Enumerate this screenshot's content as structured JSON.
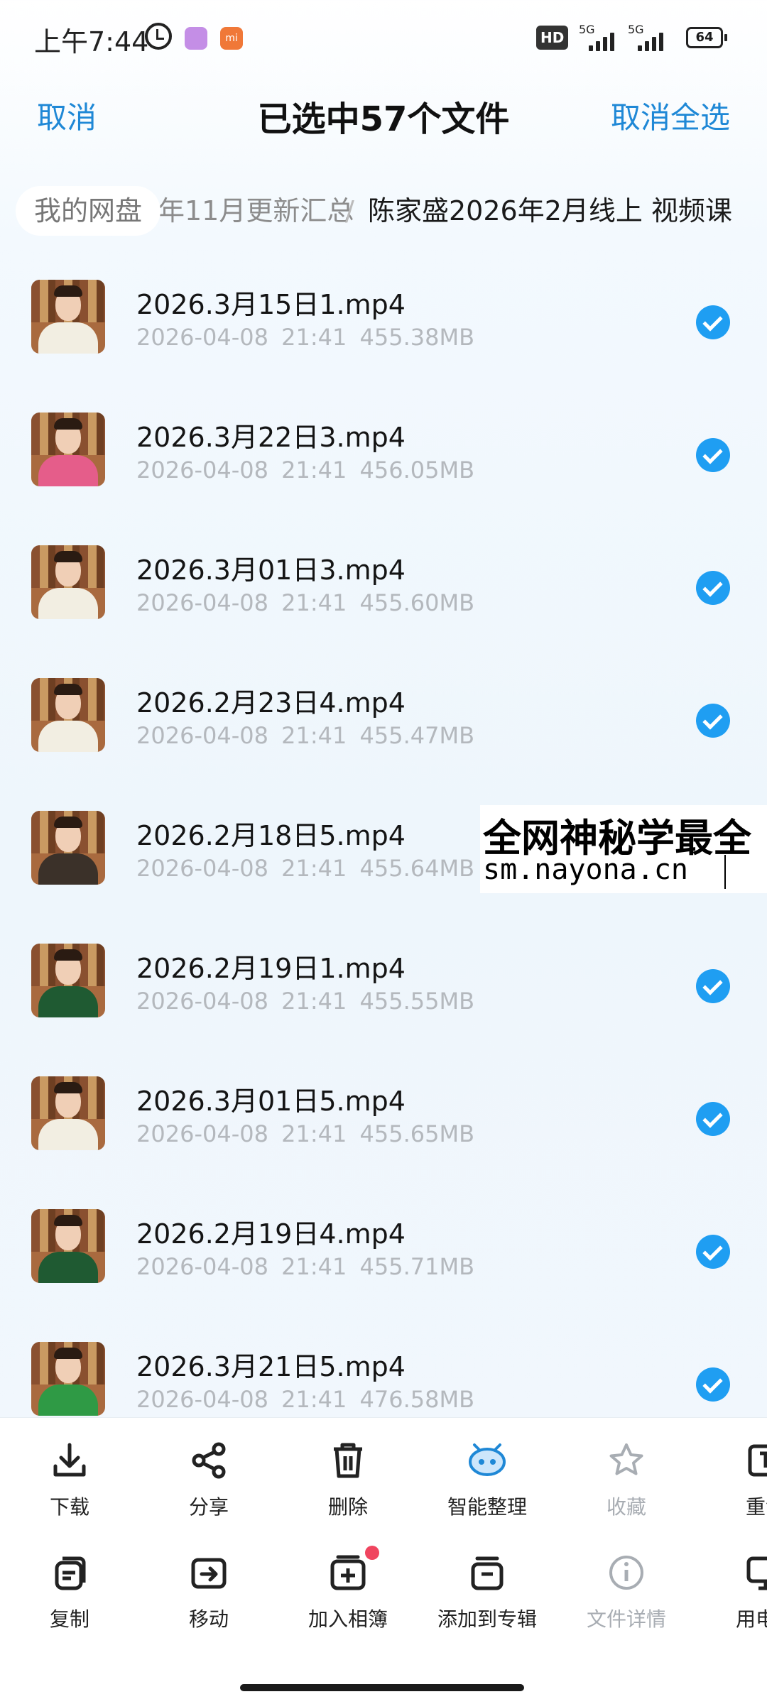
{
  "status_bar": {
    "time": "上午7:44",
    "hd": "HD",
    "network1": "5G",
    "network2": "5G",
    "battery": "64"
  },
  "header": {
    "cancel": "取消",
    "title": "已选中57个文件",
    "deselect_all": "取消全选"
  },
  "breadcrumb": {
    "root": "我的网盘",
    "middle": "年11月更新汇总",
    "current": "陈家盛2026年2月线上 视频课"
  },
  "files": [
    {
      "name": "2026.3月15日1.mp4",
      "date": "2026-04-08",
      "time": "21:41",
      "size": "455.38MB",
      "selected": true
    },
    {
      "name": "2026.3月22日3.mp4",
      "date": "2026-04-08",
      "time": "21:41",
      "size": "456.05MB",
      "selected": true
    },
    {
      "name": "2026.3月01日3.mp4",
      "date": "2026-04-08",
      "time": "21:41",
      "size": "455.60MB",
      "selected": true
    },
    {
      "name": "2026.2月23日4.mp4",
      "date": "2026-04-08",
      "time": "21:41",
      "size": "455.47MB",
      "selected": true
    },
    {
      "name": "2026.2月18日5.mp4",
      "date": "2026-04-08",
      "time": "21:41",
      "size": "455.64MB",
      "selected": true
    },
    {
      "name": "2026.2月19日1.mp4",
      "date": "2026-04-08",
      "time": "21:41",
      "size": "455.55MB",
      "selected": true
    },
    {
      "name": "2026.3月01日5.mp4",
      "date": "2026-04-08",
      "time": "21:41",
      "size": "455.65MB",
      "selected": true
    },
    {
      "name": "2026.2月19日4.mp4",
      "date": "2026-04-08",
      "time": "21:41",
      "size": "455.71MB",
      "selected": true
    },
    {
      "name": "2026.3月21日5.mp4",
      "date": "2026-04-08",
      "time": "21:41",
      "size": "476.58MB",
      "selected": true
    }
  ],
  "watermark": {
    "line1": "全网神秘学最全",
    "line2": "sm.nayona.cn"
  },
  "actions_row1": [
    {
      "label": "下载",
      "icon": "download-icon",
      "enabled": true
    },
    {
      "label": "分享",
      "icon": "share-icon",
      "enabled": true
    },
    {
      "label": "删除",
      "icon": "trash-icon",
      "enabled": true
    },
    {
      "label": "智能整理",
      "icon": "smart-organize-icon",
      "enabled": true
    },
    {
      "label": "收藏",
      "icon": "star-icon",
      "enabled": false
    },
    {
      "label": "重命",
      "icon": "rename-icon",
      "enabled": true
    }
  ],
  "actions_row2": [
    {
      "label": "复制",
      "icon": "copy-icon",
      "enabled": true
    },
    {
      "label": "移动",
      "icon": "move-icon",
      "enabled": true
    },
    {
      "label": "加入相簿",
      "icon": "add-album-icon",
      "enabled": true
    },
    {
      "label": "添加到专辑",
      "icon": "add-to-collection-icon",
      "enabled": true
    },
    {
      "label": "文件详情",
      "icon": "info-icon",
      "enabled": false
    },
    {
      "label": "用电脑",
      "icon": "monitor-icon",
      "enabled": true
    }
  ],
  "colors": {
    "accent": "#1f88d6",
    "check": "#1f9ef2",
    "meta_text": "#b4b8bd",
    "disabled_text": "#a8adb3",
    "badge": "#f0455f"
  }
}
